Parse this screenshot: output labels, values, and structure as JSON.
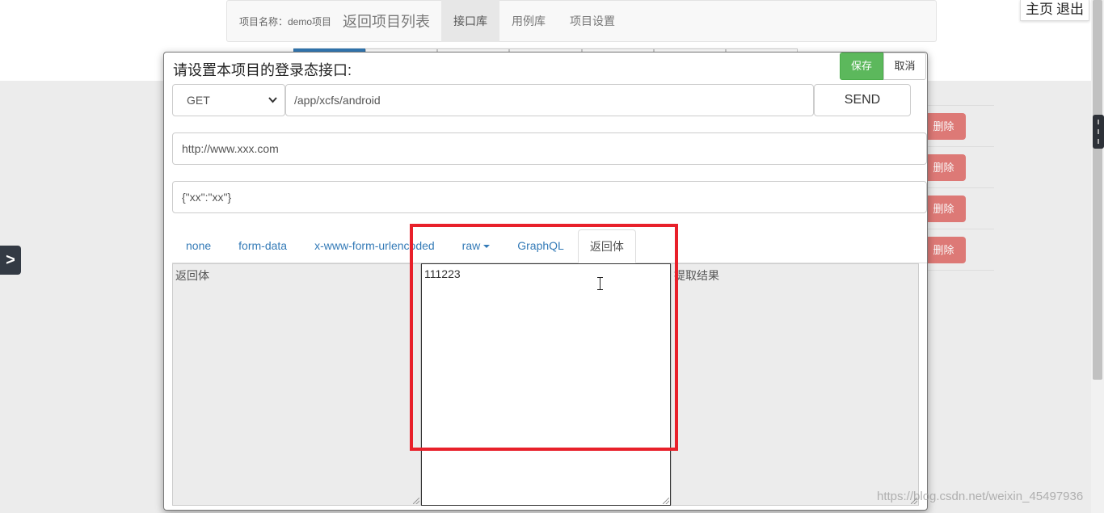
{
  "topnav": {
    "project_label": "项目名称：demo项目",
    "back_link": "返回项目列表",
    "items": [
      "接口库",
      "用例库",
      "项目设置"
    ],
    "active_index": 0
  },
  "top_right": {
    "home": "主页",
    "logout": "退出"
  },
  "background_table": {
    "delete_label": "删除",
    "rows": 4
  },
  "side_toggle": ">",
  "modal": {
    "title": "请设置本项目的登录态接口:",
    "save_label": "保存",
    "cancel_label": "取消",
    "method": "GET",
    "url": "/app/xcfs/android",
    "send_label": "SEND",
    "host": "http://www.xxx.com",
    "params": "{\"xx\":\"xx\"}",
    "body_tabs": [
      "none",
      "form-data",
      "x-www-form-urlencoded",
      "raw",
      "GraphQL",
      "返回体"
    ],
    "active_tab_index": 5,
    "response_label": "返回体",
    "middle_value": "111223",
    "extract_label": "提取结果"
  },
  "watermark": "https://blog.csdn.net/weixin_45497936",
  "colors": {
    "save_green": "#5cb85c",
    "delete_red": "#d9534f",
    "link_blue": "#337ab7",
    "highlight_red": "#e8202a"
  },
  "icons": {
    "chevron": "chevron-down-icon",
    "caret": "caret-down-icon",
    "cursor": "text-cursor-icon"
  }
}
